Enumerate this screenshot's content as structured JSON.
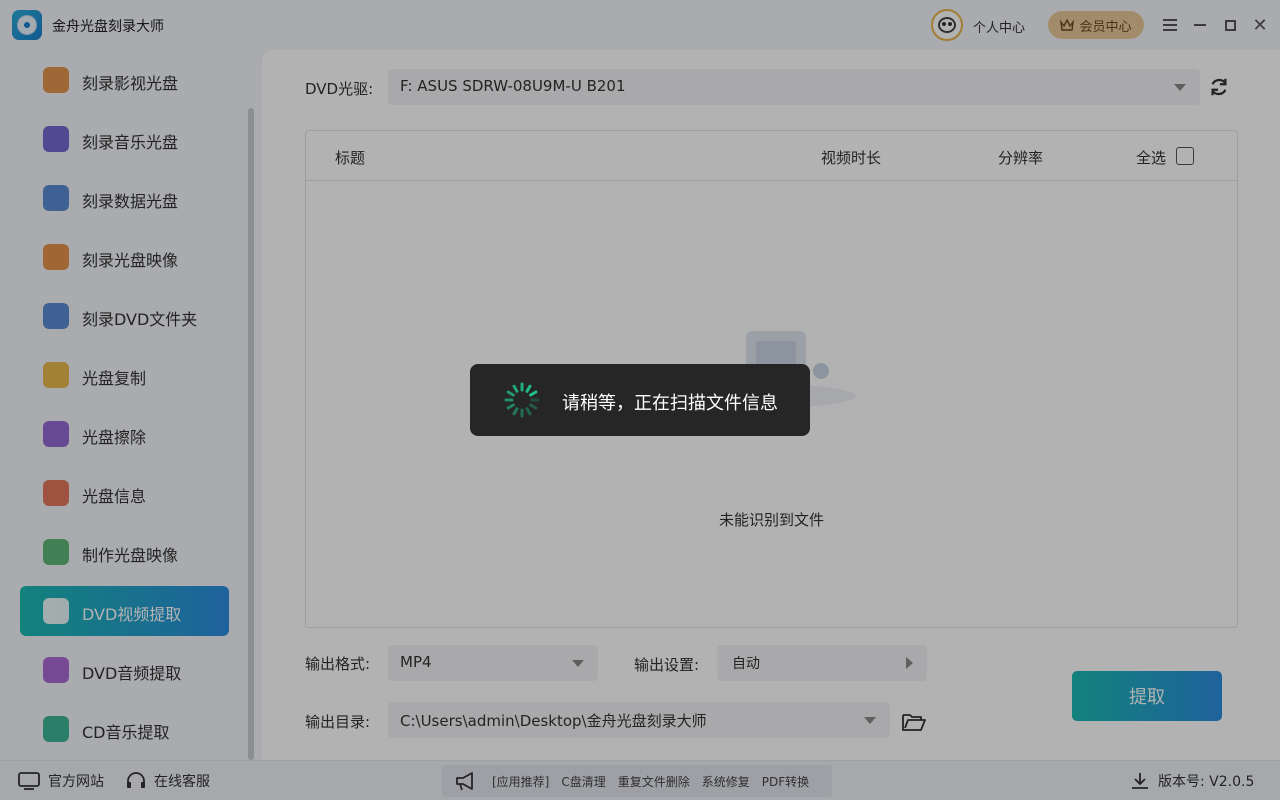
{
  "app": {
    "title": "金舟光盘刻录大师"
  },
  "header": {
    "profile_label": "个人中心",
    "vip_label": "会员中心"
  },
  "sidebar": {
    "items": [
      {
        "label": "刻录影视光盘",
        "icon": "video-disc-icon",
        "color": "#e08a3a"
      },
      {
        "label": "刻录音乐光盘",
        "icon": "music-disc-icon",
        "color": "#6a5acd"
      },
      {
        "label": "刻录数据光盘",
        "icon": "data-disc-icon",
        "color": "#4a7fd0"
      },
      {
        "label": "刻录光盘映像",
        "icon": "disc-image-icon",
        "color": "#e38a3a"
      },
      {
        "label": "刻录DVD文件夹",
        "icon": "dvd-folder-icon",
        "color": "#4a7fd0"
      },
      {
        "label": "光盘复制",
        "icon": "disc-copy-icon",
        "color": "#e6b23a"
      },
      {
        "label": "光盘擦除",
        "icon": "disc-erase-icon",
        "color": "#8a5ad0"
      },
      {
        "label": "光盘信息",
        "icon": "disc-info-icon",
        "color": "#e06a4a"
      },
      {
        "label": "制作光盘映像",
        "icon": "make-image-icon",
        "color": "#4caf6a"
      },
      {
        "label": "DVD视频提取",
        "icon": "dvd-video-extract-icon",
        "color": "#2c8de0"
      },
      {
        "label": "DVD音频提取",
        "icon": "dvd-audio-extract-icon",
        "color": "#a05ad0"
      },
      {
        "label": "CD音乐提取",
        "icon": "cd-music-extract-icon",
        "color": "#2ab08a"
      }
    ],
    "active_index": 9
  },
  "main": {
    "drive_label": "DVD光驱:",
    "drive_value": "F: ASUS SDRW-08U9M-U B201",
    "columns": {
      "title": "标题",
      "duration": "视频时长",
      "resolution": "分辨率",
      "select_all": "全选"
    },
    "empty_text": "未能识别到文件",
    "format_label": "输出格式:",
    "format_value": "MP4",
    "settings_label": "输出设置:",
    "settings_value": "自动",
    "dir_label": "输出目录:",
    "dir_value": "C:\\Users\\admin\\Desktop\\金舟光盘刻录大师",
    "extract_label": "提取"
  },
  "footer": {
    "website": "官方网站",
    "support": "在线客服",
    "rec_prefix": "[应用推荐]",
    "rec_items": [
      "C盘清理",
      "重复文件删除",
      "系统修复",
      "PDF转换"
    ],
    "version": "版本号: V2.0.5"
  },
  "toast": {
    "message": "请稍等，正在扫描文件信息"
  }
}
